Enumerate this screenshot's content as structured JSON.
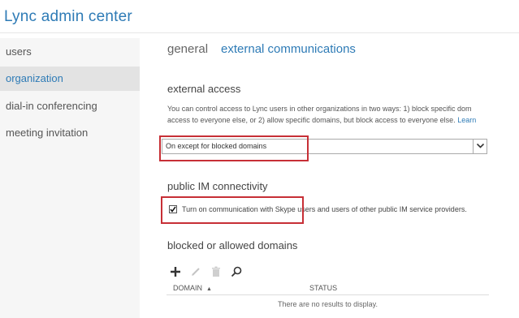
{
  "app": {
    "title": "Lync admin center"
  },
  "sidebar": {
    "items": [
      {
        "label": "users"
      },
      {
        "label": "organization"
      },
      {
        "label": "dial-in conferencing"
      },
      {
        "label": "meeting invitation"
      }
    ],
    "active": "organization"
  },
  "tabs": [
    {
      "label": "general"
    },
    {
      "label": "external communications"
    }
  ],
  "external_access": {
    "title": "external access",
    "description_line1": "You can control access to Lync users in other organizations in two ways: 1) block specific dom",
    "description_line2": "access to everyone else, or 2) allow specific domains, but block access to everyone else.",
    "learn_link": "Learn",
    "select_value": "On except for blocked domains"
  },
  "public_im": {
    "title": "public IM connectivity",
    "checkbox_checked": true,
    "checkbox_label": "Turn on communication with Skype users and users of other public IM service providers."
  },
  "domains": {
    "title": "blocked or allowed domains",
    "toolbar_icons": [
      "add-icon",
      "edit-icon",
      "delete-icon",
      "search-icon"
    ],
    "columns": {
      "domain": "DOMAIN",
      "status": "STATUS"
    },
    "empty_message": "There are no results to display."
  },
  "colors": {
    "accent": "#2e7bb6",
    "highlight": "#c72f36",
    "sidebar_bg": "#f6f6f6",
    "active_item_bg": "#e3e3e3"
  }
}
